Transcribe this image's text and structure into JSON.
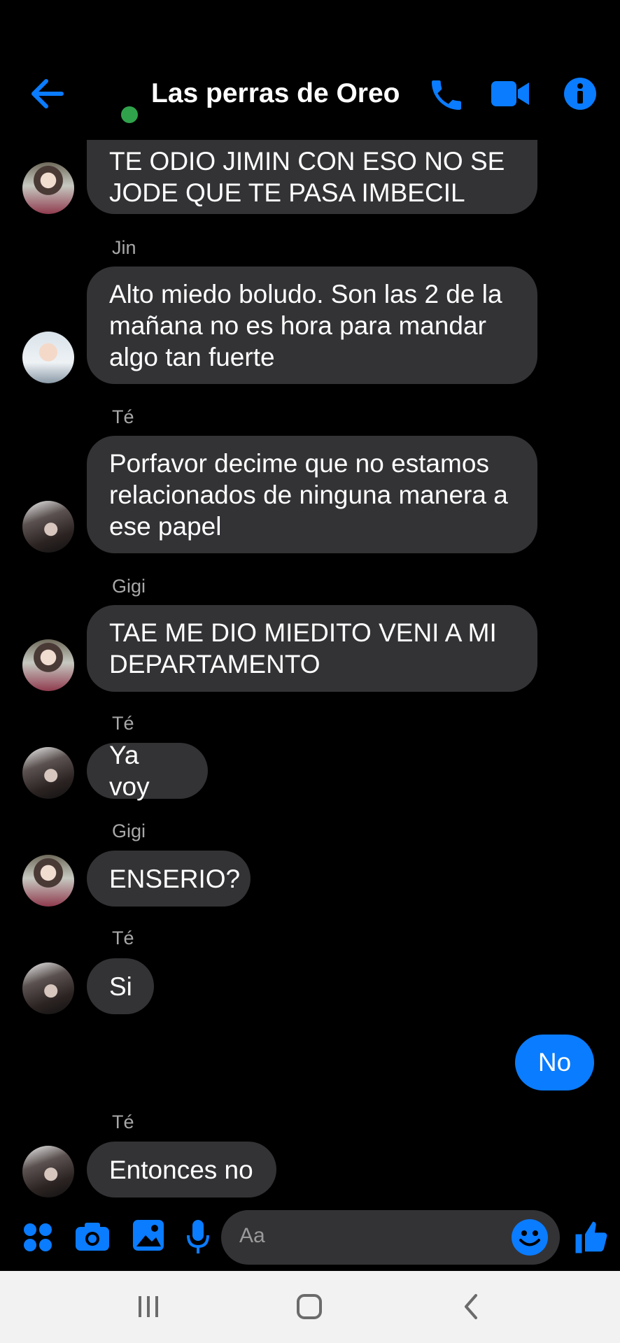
{
  "header": {
    "title": "Las perras de Oreo",
    "online_color": "#31a24c",
    "accent": "#0a7cff",
    "icons": [
      "back-arrow-icon",
      "phone-icon",
      "video-camera-icon",
      "info-icon"
    ]
  },
  "messages": [
    {
      "sender": "",
      "avatar": "jimin-avatar",
      "text": "TE ODIO JIMIN CON ESO NO SE JODE QUE TE PASA IMBECIL"
    },
    {
      "sender": "Jin",
      "avatar": "jin-avatar",
      "text": "Alto miedo boludo. Son las 2 de la mañana no es hora para mandar algo tan fuerte"
    },
    {
      "sender": "Té",
      "avatar": "te-avatar",
      "text": "Porfavor decime que no estamos relacionados de ninguna manera a ese papel"
    },
    {
      "sender": "Gigi",
      "avatar": "gigi-avatar",
      "text": "TAE ME DIO MIEDITO VENI A MI DEPARTAMENTO"
    },
    {
      "sender": "Té",
      "avatar": "te-avatar",
      "text": "Ya voy"
    },
    {
      "sender": "Gigi",
      "avatar": "gigi-avatar",
      "text": "ENSERIO?"
    },
    {
      "sender": "Té",
      "avatar": "te-avatar",
      "text": "Si"
    },
    {
      "sender": "me",
      "text": "No"
    },
    {
      "sender": "Té",
      "avatar": "te-avatar",
      "text": "Entonces no"
    }
  ],
  "composer": {
    "placeholder": "Aa",
    "icons": [
      "apps-grid-icon",
      "camera-icon",
      "gallery-icon",
      "microphone-icon",
      "emoji-icon",
      "thumbs-up-icon"
    ]
  },
  "navbar": {
    "icons": [
      "recent-apps-icon",
      "home-icon",
      "back-icon"
    ]
  }
}
